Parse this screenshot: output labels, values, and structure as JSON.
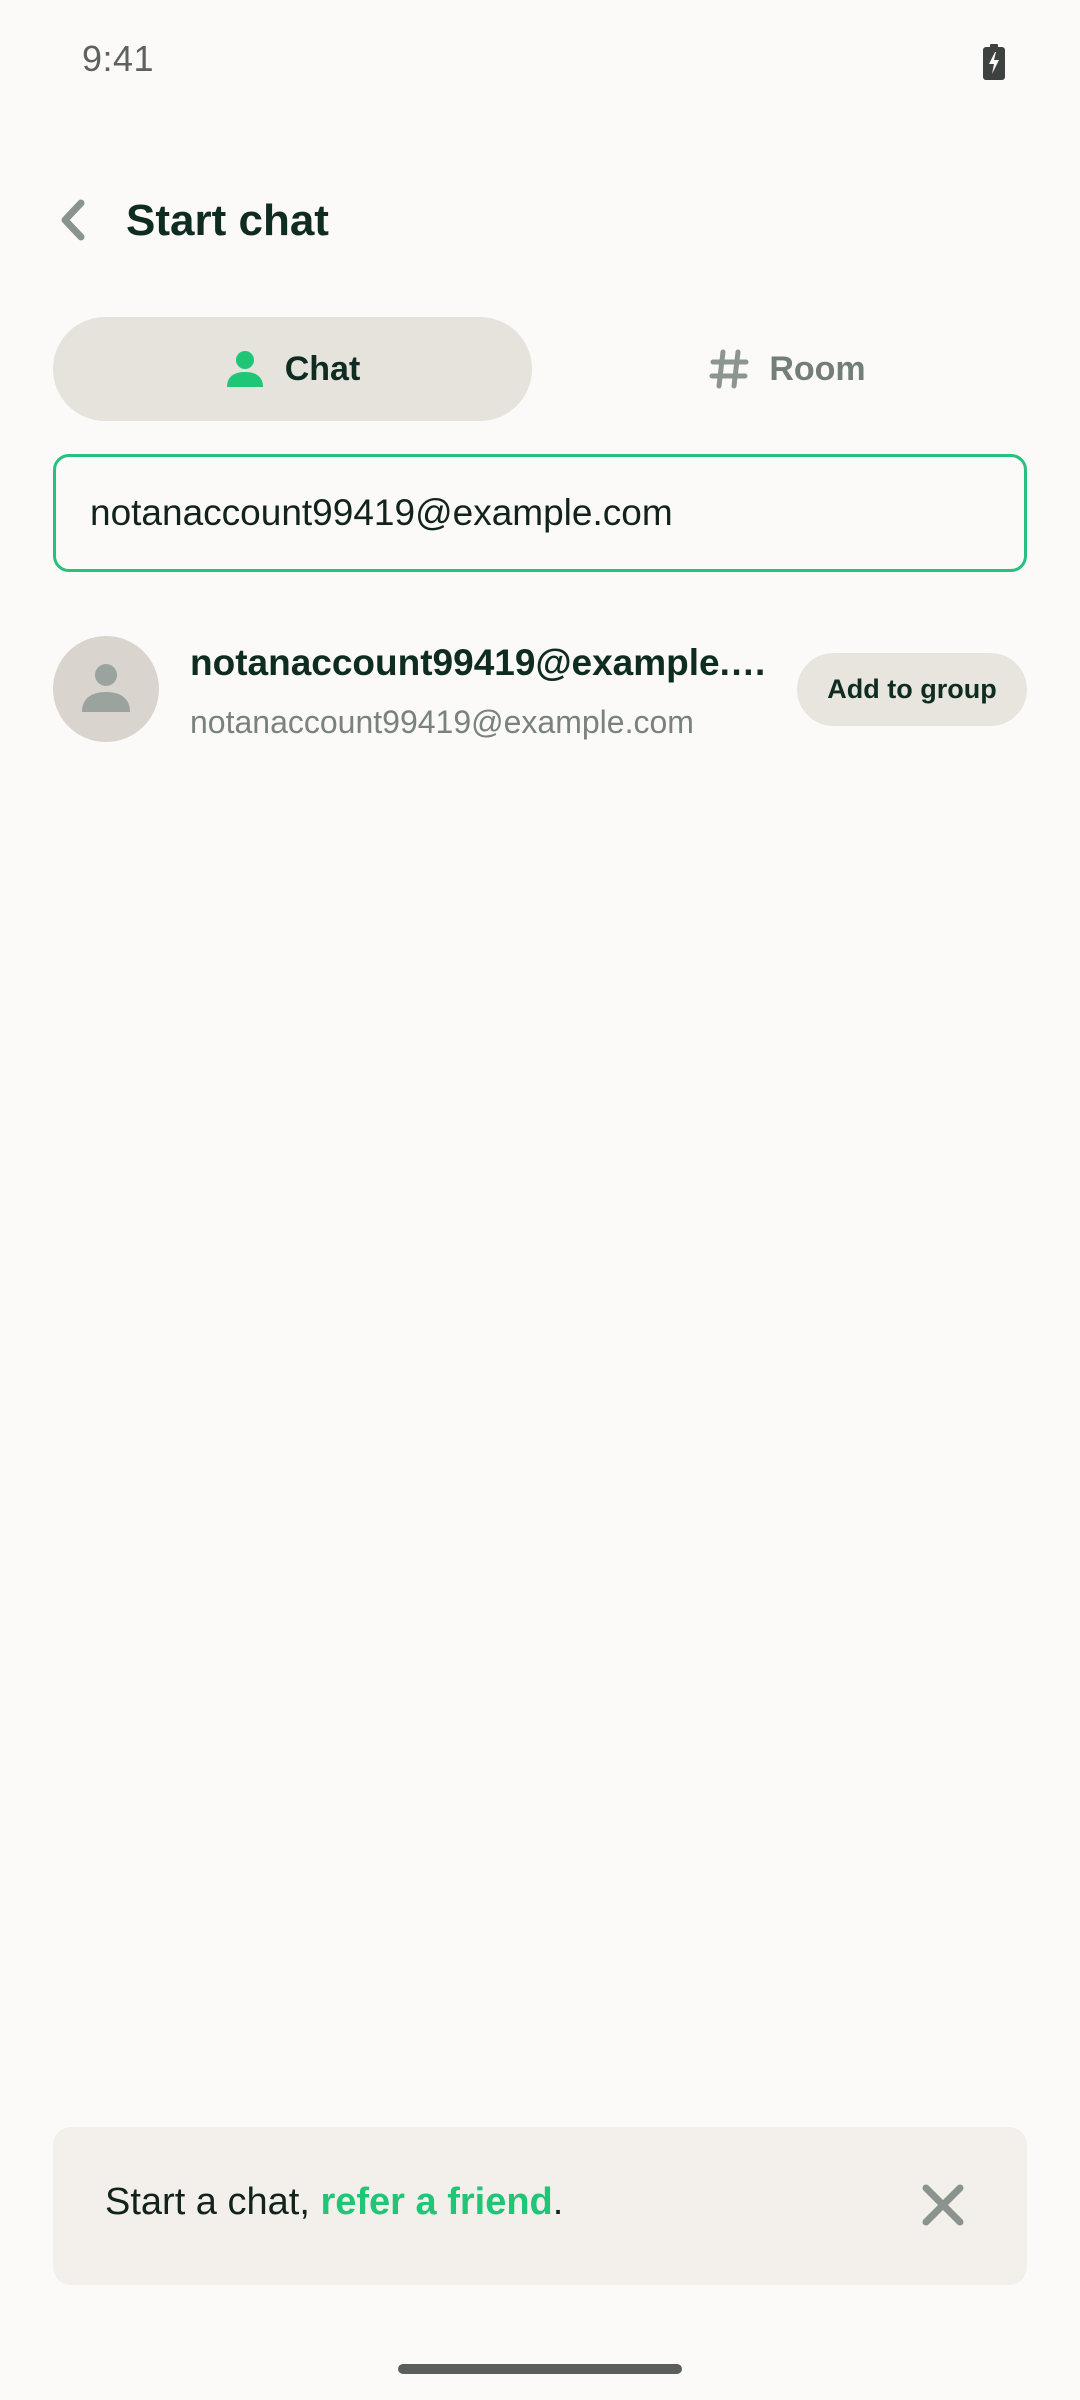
{
  "status_bar": {
    "time": "9:41",
    "battery_icon": "battery-charging-icon"
  },
  "header": {
    "back_icon": "chevron-left-icon",
    "title": "Start chat"
  },
  "tabs": [
    {
      "label": "Chat",
      "icon": "person-icon",
      "selected": true
    },
    {
      "label": "Room",
      "icon": "hash-icon",
      "selected": false
    }
  ],
  "search": {
    "value": "notanaccount99419@example.com"
  },
  "results": [
    {
      "name": "notanaccount99419@example.com",
      "subtitle": "notanaccount99419@example.com",
      "avatar_icon": "person-icon",
      "action_label": "Add to group"
    }
  ],
  "banner": {
    "text_prefix": "Start a chat, ",
    "link_label": "refer a friend",
    "text_suffix": ".",
    "close_icon": "close-icon"
  },
  "colors": {
    "accent": "#1ec676",
    "title": "#0e2c21",
    "background": "#fbfaf8"
  }
}
